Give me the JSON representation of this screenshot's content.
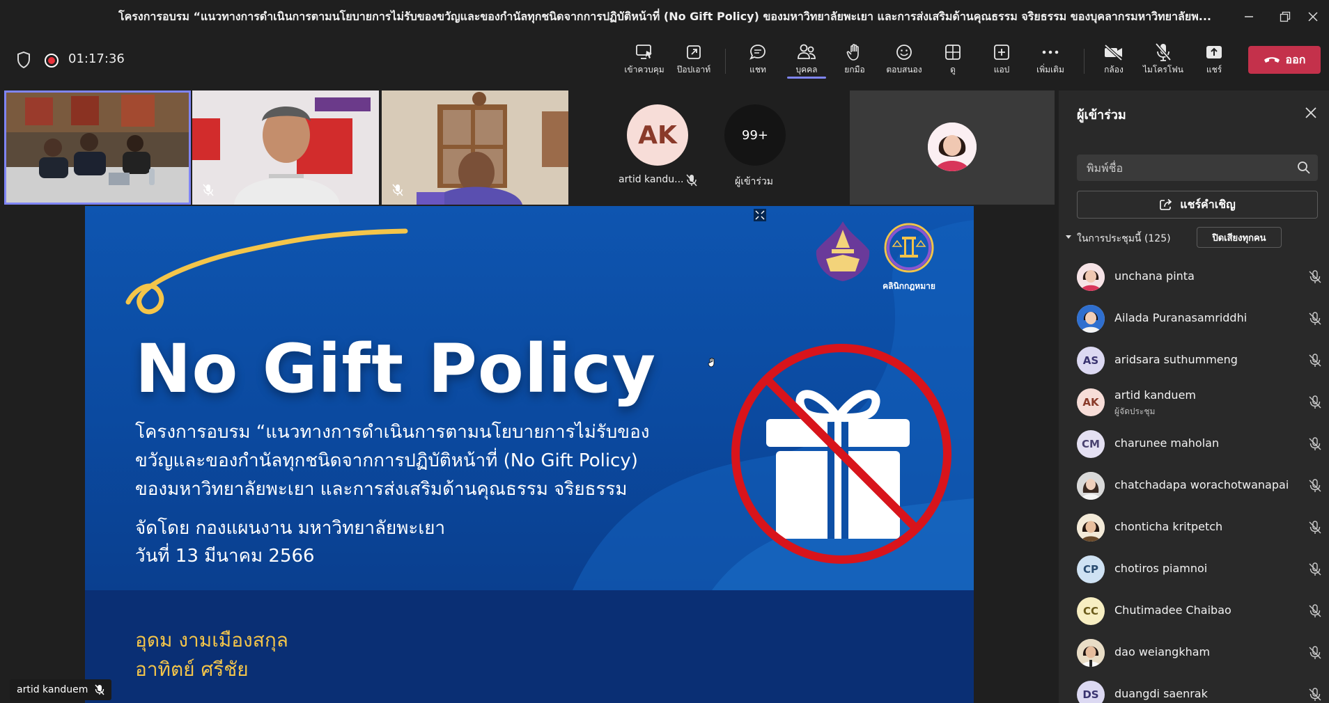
{
  "window": {
    "title": "โครงการอบรม “แนวทางการดำเนินการตามนโยบายการไม่รับของขวัญและของกำนัลทุกชนิดจากการปฏิบัติหน้าที่ (No Gift Policy) ของมหาวิทยาลัยพะเยา และการส่งเสริมด้านคุณธรรม จริยธรรม ของบุคลากรมหาวิทยาลัยพ..."
  },
  "meeting": {
    "timer": "01:17:36",
    "toolbar": [
      {
        "label": "เข้าควบคุม",
        "icon": "control-icon"
      },
      {
        "label": "ป๊อปเอาท์",
        "icon": "popout-icon"
      },
      {
        "label": "แชท",
        "icon": "chat-icon"
      },
      {
        "label": "บุคคล",
        "icon": "people-icon",
        "active": true
      },
      {
        "label": "ยกมือ",
        "icon": "hand-icon"
      },
      {
        "label": "ตอบสนอง",
        "icon": "smile-icon"
      },
      {
        "label": "ดู",
        "icon": "view-icon"
      },
      {
        "label": "แอป",
        "icon": "apps-icon"
      },
      {
        "label": "เพิ่มเติม",
        "icon": "more-icon"
      },
      {
        "label": "กล้อง",
        "icon": "camera-off-icon"
      },
      {
        "label": "ไมโครโฟน",
        "icon": "mic-off-icon"
      },
      {
        "label": "แชร์",
        "icon": "share-icon"
      }
    ],
    "leave_label": "ออก",
    "accent": "#7f85f5",
    "leave_color": "#c4314b"
  },
  "video_strip": {
    "avatar_initials": "AK",
    "avatar_name": "artid kandu...",
    "overflow_count": "99+",
    "overflow_label": "ผู้เข้าร่วม"
  },
  "slide": {
    "title": "No Gift Policy",
    "lines": [
      "โครงการอบรม “แนวทางการดำเนินการตามนโยบายการไม่รับของ",
      "ขวัญและของกำนัลทุกชนิดจากการปฏิบัติหน้าที่ (No Gift Policy)",
      "ของมหาวิทยาลัยพะเยา และการส่งเสริมด้านคุณธรรม จริยธรรม"
    ],
    "org": "จัดโดย กองแผนงาน มหาวิทยาลัยพะเยา",
    "date": "วันที่ 13 มีนาคม 2566",
    "logo_text": "คลินิกกฎหมาย",
    "speakers": [
      "อุดม งามเมืองสกุล",
      "อาทิตย์ ศรีชัย"
    ],
    "presenter": "artid kanduem",
    "name_color": "#f4c54a"
  },
  "participants": {
    "title": "ผู้เข้าร่วม",
    "search_placeholder": "พิมพ์ชื่อ",
    "invite_label": "แชร์คำเชิญ",
    "section_title": "ในการประชุมนี้ (125)",
    "mute_all_label": "ปิดเสียงทุกคน",
    "list": [
      {
        "name": "unchana pinta",
        "initials": "",
        "photo": true
      },
      {
        "name": "Ailada Puranasamriddhi",
        "initials": "",
        "photo": true
      },
      {
        "name": "aridsara suthummeng",
        "initials": "AS",
        "bg": "#dcd9f2",
        "fg": "#3a3470"
      },
      {
        "name": "artid kanduem",
        "initials": "AK",
        "bg": "#f7ddd8",
        "fg": "#8a3a2a",
        "role": "ผู้จัดประชุม"
      },
      {
        "name": "charunee maholan",
        "initials": "CM",
        "bg": "#e4e0f2",
        "fg": "#4a4270"
      },
      {
        "name": "chatchadapa worachotwanapai",
        "initials": "",
        "photo": true
      },
      {
        "name": "chonticha kritpetch",
        "initials": "",
        "photo": true
      },
      {
        "name": "chotiros piamnoi",
        "initials": "CP",
        "bg": "#cfe2f3",
        "fg": "#2a4c70"
      },
      {
        "name": "Chutimadee Chaibao",
        "initials": "CC",
        "bg": "#f7eec2",
        "fg": "#6a5a1a"
      },
      {
        "name": "dao weiangkham",
        "initials": "",
        "photo": true
      },
      {
        "name": "duangdi saenrak",
        "initials": "DS",
        "bg": "#dcd9f2",
        "fg": "#3a3470"
      }
    ]
  }
}
